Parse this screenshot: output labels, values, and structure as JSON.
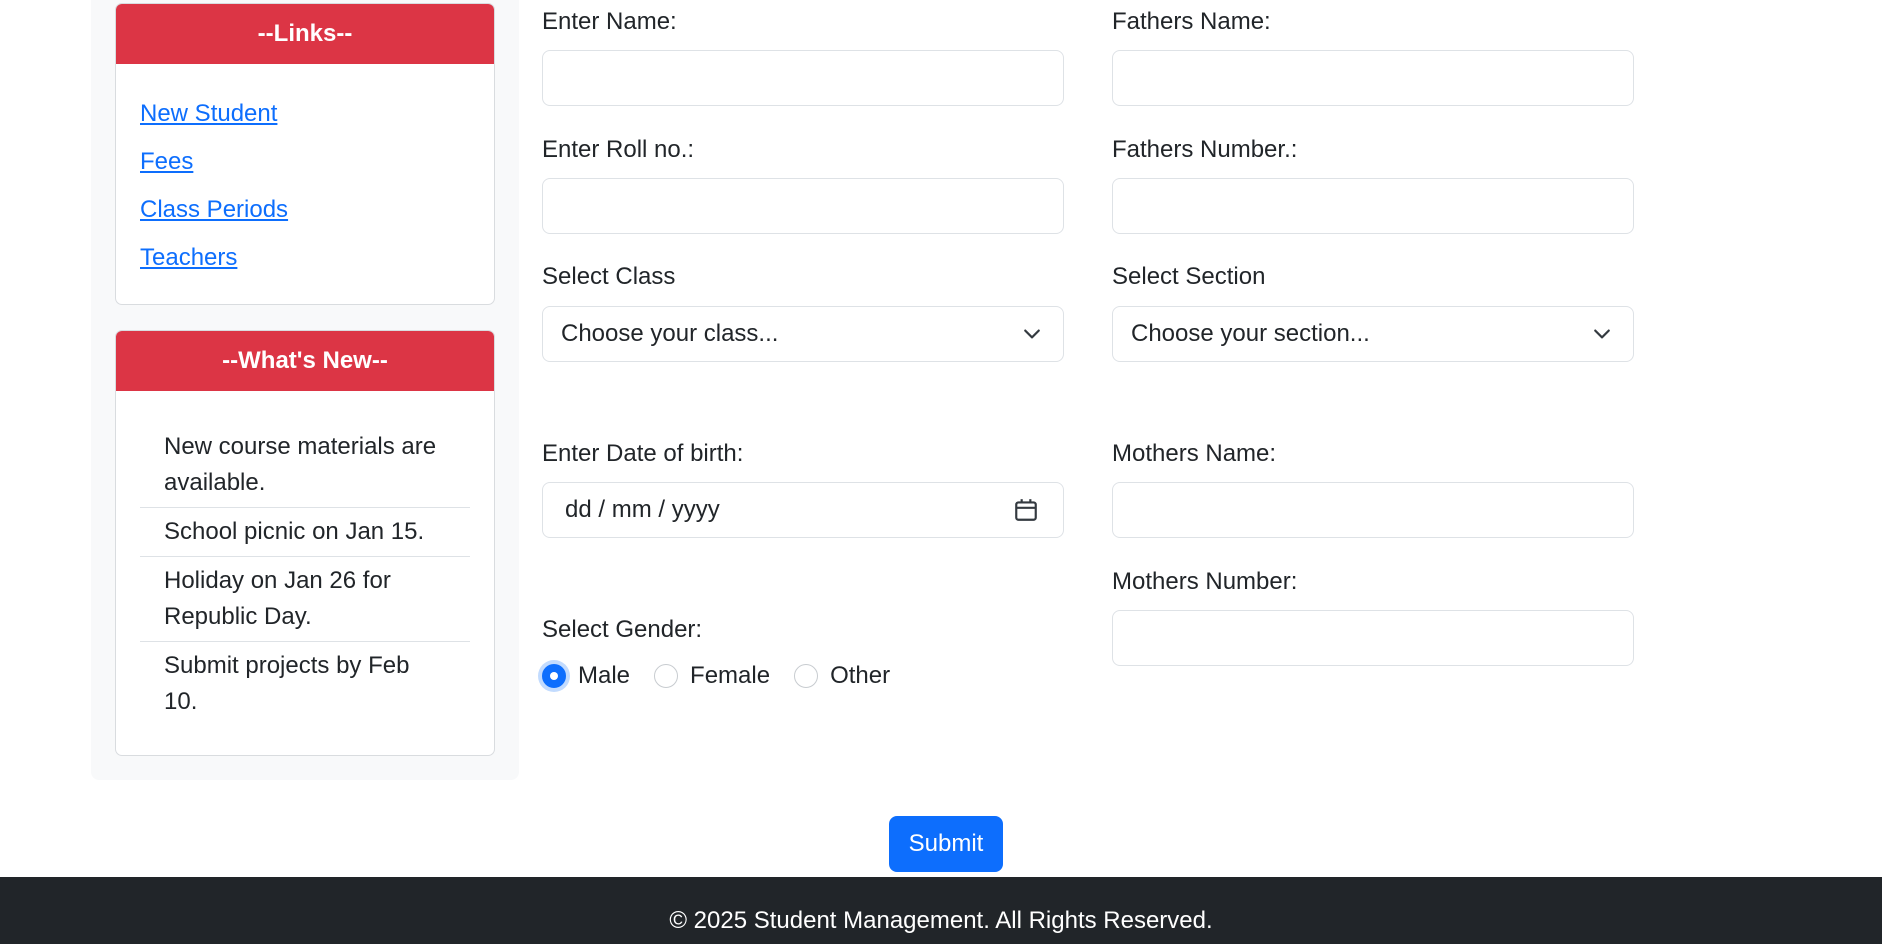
{
  "sidebar": {
    "links": {
      "title": "--Links--",
      "items": [
        "New Student",
        "Fees",
        "Class Periods",
        "Teachers"
      ]
    },
    "news": {
      "title": "--What's New--",
      "items": [
        "New course materials are available.",
        "School picnic on Jan 15.",
        "Holiday on Jan 26 for Republic Day.",
        "Submit projects by Feb 10."
      ]
    }
  },
  "form": {
    "name_label": "Enter Name:",
    "fathers_name_label": "Fathers Name:",
    "roll_label": "Enter Roll no.:",
    "fathers_number_label": "Fathers Number.:",
    "class_label": "Select Class",
    "class_selected": "Choose your class...",
    "section_label": "Select Section",
    "section_selected": "Choose your section...",
    "dob_label": "Enter Date of birth:",
    "dob_placeholder": "dd / mm / yyyy",
    "mothers_name_label": "Mothers Name:",
    "mothers_number_label": "Mothers Number:",
    "gender_label": "Select Gender:",
    "gender_options": [
      "Male",
      "Female",
      "Other"
    ],
    "gender_selected": "Male",
    "submit_label": "Submit"
  },
  "footer": {
    "text": "© 2025 Student Management. All Rights Reserved."
  },
  "colors": {
    "primary": "#0d6efd",
    "danger": "#dc3545",
    "dark": "#212529"
  }
}
